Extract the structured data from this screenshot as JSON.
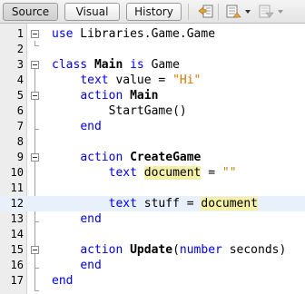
{
  "tabs": [
    {
      "label": "Source",
      "active": true
    },
    {
      "label": "Visual",
      "active": false
    },
    {
      "label": "History",
      "active": false
    }
  ],
  "toolbar_icons": [
    "back-history-icon",
    "previous-change-icon",
    "next-change-icon"
  ],
  "colors": {
    "keyword": "#0000e6",
    "string": "#ce7b00",
    "highlight": "#f5f0a8",
    "current_line": "#e8f0fb"
  },
  "editor": {
    "lines": [
      {
        "num": "1"
      },
      {
        "num": "2"
      },
      {
        "num": "3"
      },
      {
        "num": "4"
      },
      {
        "num": "5"
      },
      {
        "num": "6"
      },
      {
        "num": "7"
      },
      {
        "num": "8"
      },
      {
        "num": "9"
      },
      {
        "num": "10"
      },
      {
        "num": "11"
      },
      {
        "num": "12"
      },
      {
        "num": "13"
      },
      {
        "num": "14"
      },
      {
        "num": "15"
      },
      {
        "num": "16"
      },
      {
        "num": "17"
      }
    ],
    "tokens": {
      "use": "use",
      "import_path": " Libraries.Game.Game",
      "class_kw": "class",
      "class_name": "Main",
      "is_kw": "is",
      "base_class": " Game",
      "text_kw": "text",
      "value_var": " value = ",
      "hi_str": "\"Hi\"",
      "action_kw": "action",
      "main_action": "Main",
      "start_game": "StartGame()",
      "end_kw": "end",
      "create_game": "CreateGame",
      "document_var": "document",
      "equals": " = ",
      "empty_str": "\"\"",
      "stuff_var": " stuff = ",
      "update_name": "Update",
      "open_paren": "(",
      "number_kw": "number",
      "seconds_param": " seconds)"
    }
  }
}
